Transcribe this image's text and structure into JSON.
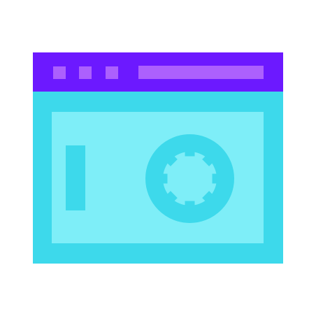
{
  "icon": {
    "name": "web-vault-safe-icon",
    "colors": {
      "window_body": "#3dd9eb",
      "title_bar": "#6c19ff",
      "title_bar_elements": "#ac60fd",
      "panel": "#7eeef8",
      "dial_and_handle": "#3dd9eb"
    }
  }
}
